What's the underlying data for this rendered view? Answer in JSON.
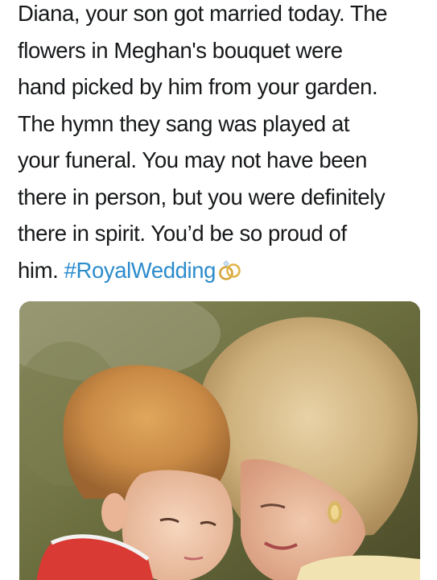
{
  "tweet": {
    "lines": [
      "Diana, your son got married today. The",
      "flowers in Meghan's bouquet were",
      "hand picked by him from your garden.",
      "The hymn they sang was played at",
      "your funeral. You may not have been",
      "there in person, but you were definitely",
      "there in spirit. You’d be so proud of"
    ],
    "last_line_prefix": "him. ",
    "hashtag": "#RoyalWedding",
    "hashtag_color": "#2b8ccc",
    "emoji": "rings-icon"
  },
  "media": {
    "type": "photo",
    "subject": "photo-of-woman-hugging-child"
  },
  "colors": {
    "text": "#16181a",
    "background": "#ffffff"
  }
}
